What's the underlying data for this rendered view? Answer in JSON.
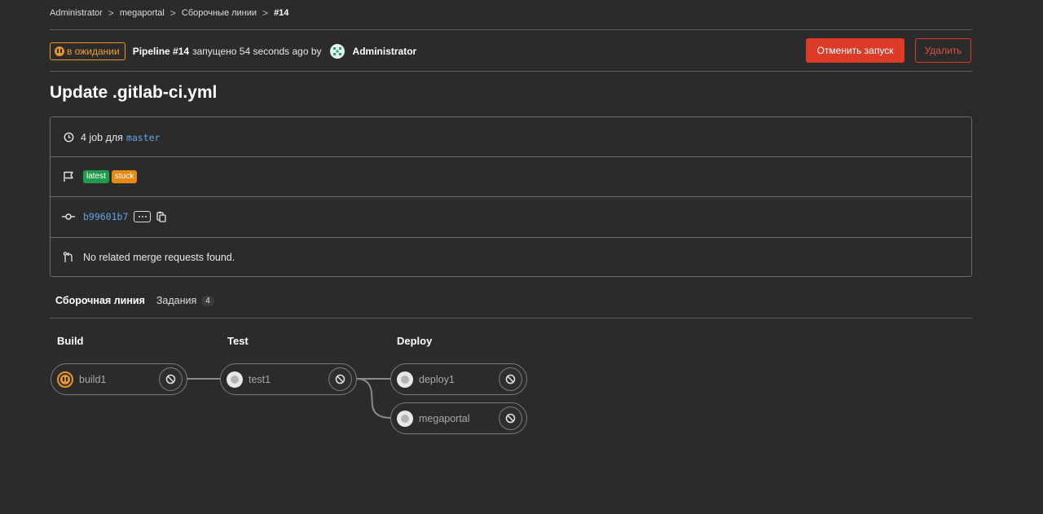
{
  "breadcrumb": {
    "items": [
      "Administrator",
      "megaportal",
      "Сборочные линии"
    ],
    "current": "#14",
    "separator": ">"
  },
  "header": {
    "status": "в ожидании",
    "pipeline_label": "Pipeline #14",
    "triggered_text": "запущено 54 seconds ago by",
    "user": "Administrator",
    "cancel_button": "Отменить запуск",
    "delete_button": "Удалить"
  },
  "commit_title": "Update .gitlab-ci.yml",
  "info": {
    "jobs_text": "4 job для",
    "branch": "master",
    "tags": [
      "latest",
      "stuck"
    ],
    "commit_sha": "b99601b7",
    "merge_requests": "No related merge requests found."
  },
  "tabs": {
    "pipeline": "Сборочная линия",
    "jobs": "Задания",
    "jobs_count": "4"
  },
  "stages": [
    {
      "name": "Build",
      "jobs": [
        {
          "name": "build1",
          "status": "pending"
        }
      ]
    },
    {
      "name": "Test",
      "jobs": [
        {
          "name": "test1",
          "status": "created"
        }
      ]
    },
    {
      "name": "Deploy",
      "jobs": [
        {
          "name": "deploy1",
          "status": "created"
        },
        {
          "name": "megaportal",
          "status": "created"
        }
      ]
    }
  ],
  "colors": {
    "background": "#2b2b2b",
    "danger": "#dd3b28",
    "warning": "#e5962a",
    "link": "#63a4e8",
    "tag_latest": "#1f9c4b",
    "tag_stuck": "#e58a13"
  },
  "icons": {
    "status": "pause-icon",
    "jobs_row": "clock-icon",
    "tags_row": "flag-icon",
    "commit_row": "commit-icon",
    "mr_row": "merge-request-icon",
    "job_action": "cancel-icon",
    "copy": "clipboard-icon"
  }
}
